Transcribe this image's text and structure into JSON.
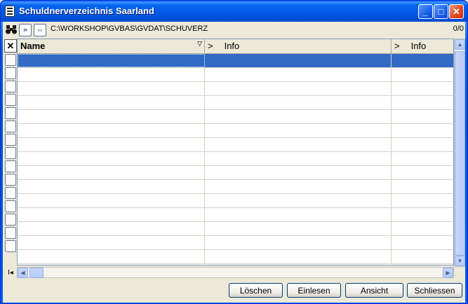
{
  "window": {
    "title": "Schuldnerverzeichnis Saarland",
    "minimize": "_",
    "maximize": "□",
    "close": "✕"
  },
  "toolbar": {
    "search_icon": "binoculars-icon",
    "forward_label": "»",
    "swap_label": "⇔",
    "path": "C:\\WORKSHOP\\GVBAS\\GVDAT\\SCHUVERZ",
    "count": "0/0"
  },
  "rowselector": {
    "header": "✕"
  },
  "grid": {
    "columns": [
      {
        "label": "Name",
        "prefix": ""
      },
      {
        "label": "Info",
        "prefix": ">"
      },
      {
        "label": "Info",
        "prefix": ">"
      }
    ],
    "sort_indicator": "▽",
    "rows": 15
  },
  "nav": {
    "first": "I◂"
  },
  "buttons": {
    "loeschen": "Löschen",
    "einlesen": "Einlesen",
    "ansicht": "Ansicht",
    "schliessen": "Schliessen"
  }
}
